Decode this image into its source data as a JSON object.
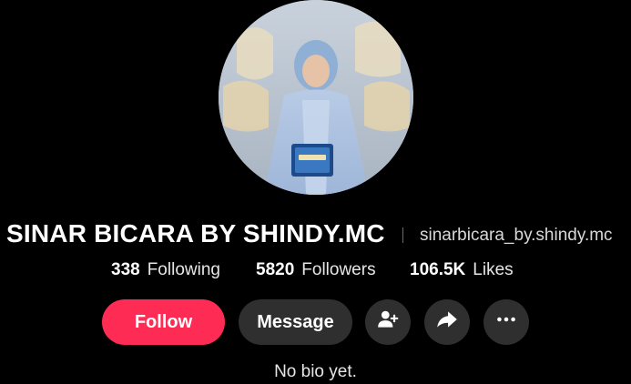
{
  "profile": {
    "display_name": "SINAR BICARA BY SHINDY.MC",
    "username": "sinarbicara_by.shindy.mc",
    "avatar_icon": "profile-photo"
  },
  "stats": {
    "following": {
      "value": "338",
      "label": "Following"
    },
    "followers": {
      "value": "5820",
      "label": "Followers"
    },
    "likes": {
      "value": "106.5K",
      "label": "Likes"
    }
  },
  "actions": {
    "follow_label": "Follow",
    "message_label": "Message",
    "add_friend_icon": "person-add-icon",
    "share_icon": "share-arrow-icon",
    "more_icon": "more-dots-icon"
  },
  "bio": "No bio yet.",
  "colors": {
    "background": "#000000",
    "follow_button": "#fe2c55",
    "secondary_button": "#2f2f2f",
    "text": "#ffffff"
  }
}
